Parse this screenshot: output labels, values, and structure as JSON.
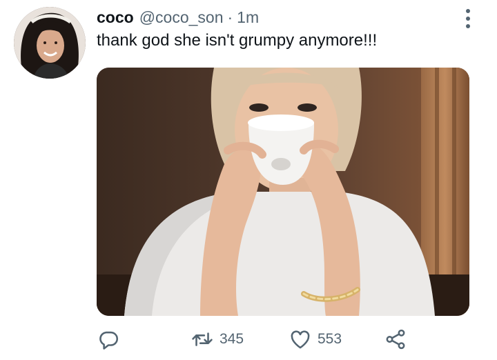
{
  "tweet": {
    "display_name": "coco",
    "handle": "@coco_son",
    "separator": "·",
    "time": "1m",
    "text": "thank god she isn't grumpy anymore!!!"
  },
  "icons": {
    "avatar": "avatar",
    "more": "more-vertical-icon",
    "reply": "reply-icon",
    "retweet": "retweet-icon",
    "like": "heart-icon",
    "share": "share-icon"
  },
  "actions": {
    "retweet_count": "345",
    "like_count": "553"
  },
  "colors": {
    "text_primary": "#0f1419",
    "text_secondary": "#536471"
  }
}
